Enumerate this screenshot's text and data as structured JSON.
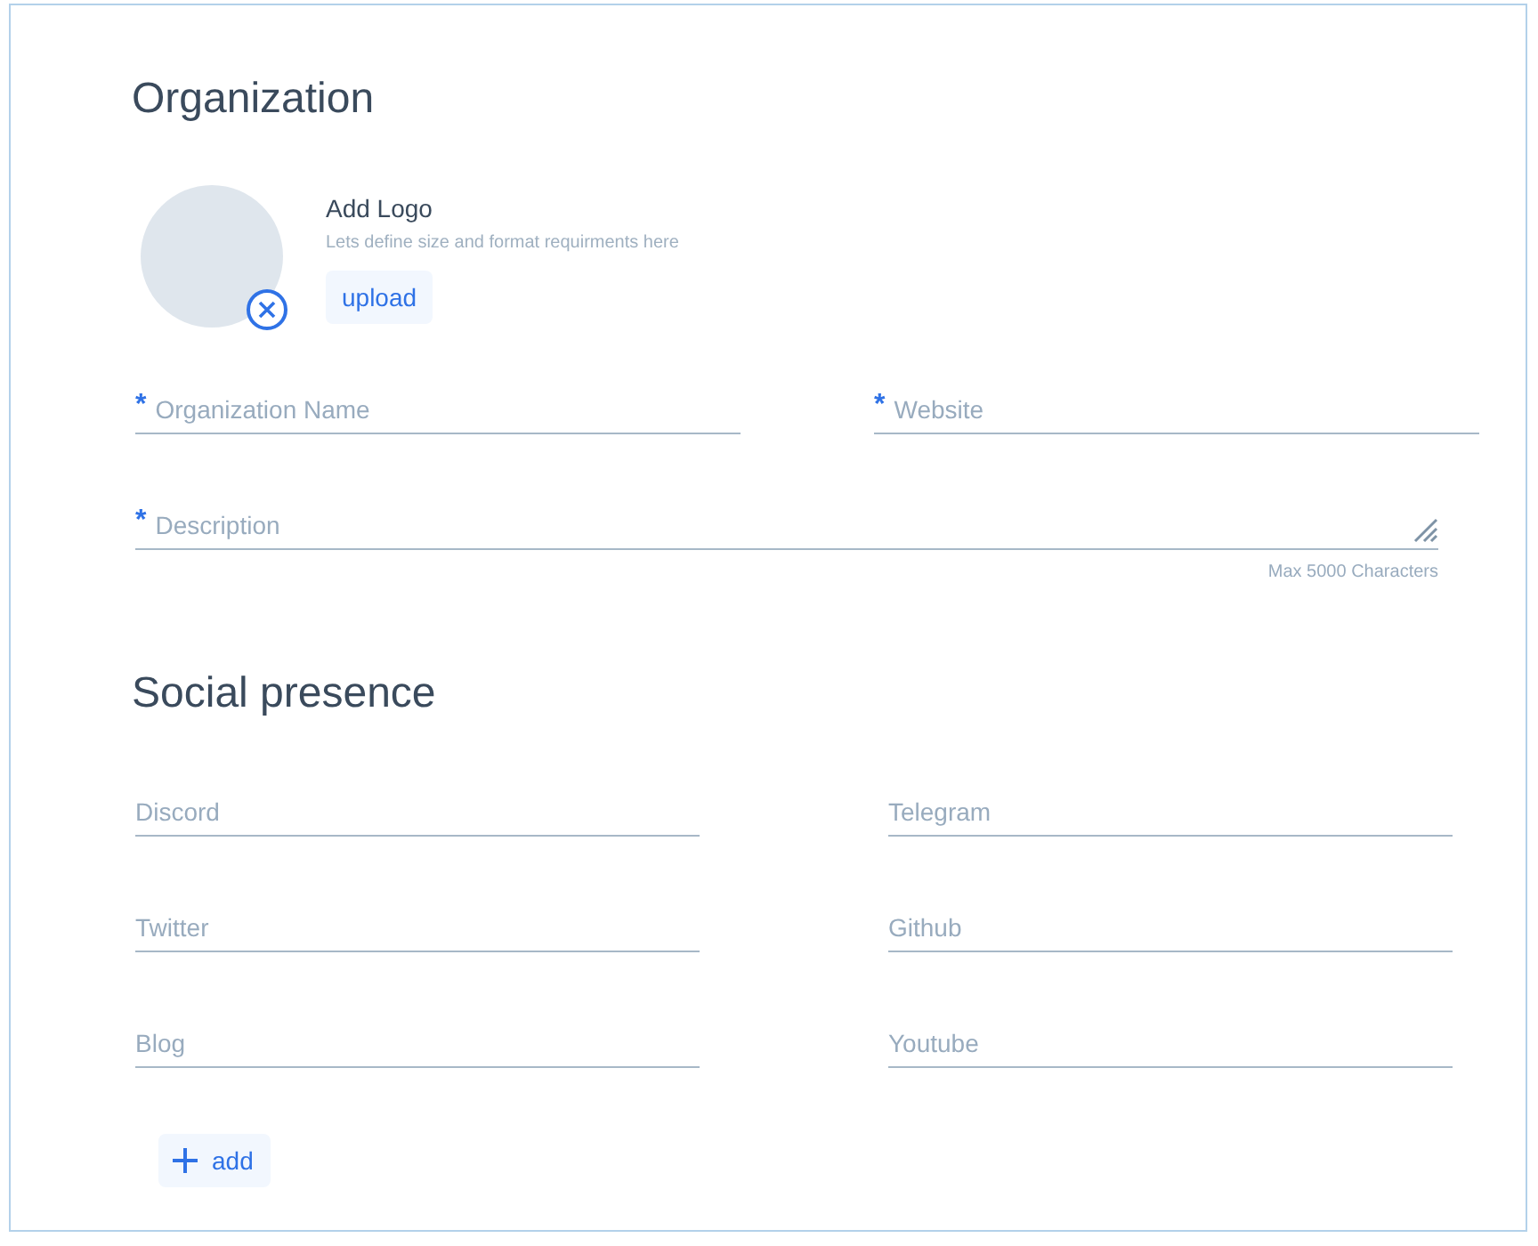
{
  "organization": {
    "title": "Organization",
    "logo": {
      "title": "Add Logo",
      "hint": "Lets define size and format requirments here",
      "upload_button": "upload"
    },
    "fields": [
      {
        "kind": "input",
        "required_mark": "*",
        "placeholder": "Organization Name"
      },
      {
        "kind": "input",
        "required_mark": "*",
        "placeholder": "Website"
      },
      {
        "kind": "textarea",
        "required_mark": "*",
        "placeholder": "Description",
        "helper": "Max 5000 Characters"
      }
    ]
  },
  "social_presence": {
    "title": "Social presence",
    "fields": [
      {
        "placeholder": "Discord"
      },
      {
        "placeholder": "Telegram"
      },
      {
        "placeholder": "Twitter"
      },
      {
        "placeholder": "Github"
      },
      {
        "placeholder": "Blog"
      },
      {
        "placeholder": "Youtube"
      }
    ],
    "add_button": "add"
  }
}
